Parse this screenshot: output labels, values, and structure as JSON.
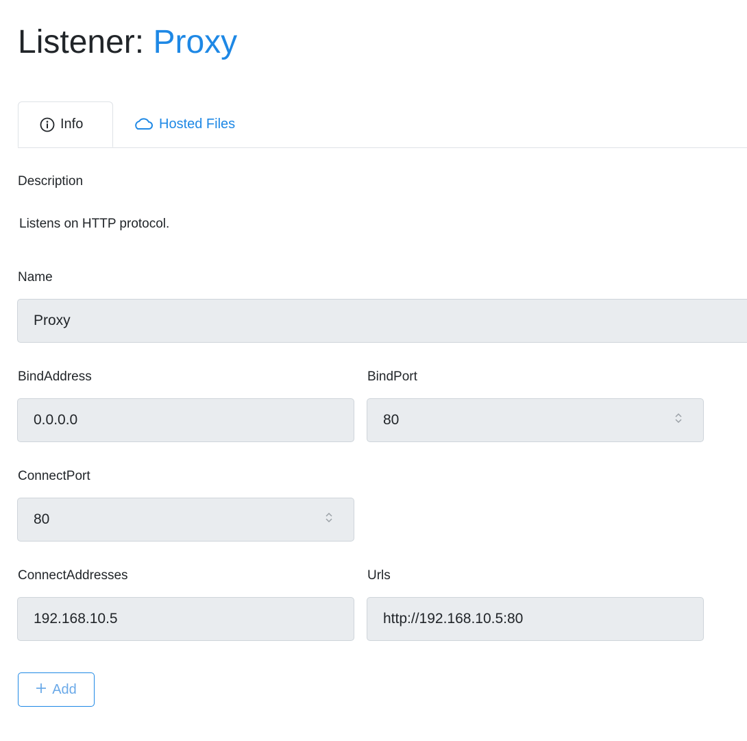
{
  "header": {
    "title_prefix": "Listener:",
    "title_name": "Proxy"
  },
  "tabs": [
    {
      "label": "Info",
      "icon": "info-icon",
      "active": true
    },
    {
      "label": "Hosted Files",
      "icon": "cloud-icon",
      "active": false
    }
  ],
  "form": {
    "description_label": "Description",
    "description_text": "Listens on HTTP protocol.",
    "name_label": "Name",
    "name_value": "Proxy",
    "bind_address_label": "BindAddress",
    "bind_address_value": "0.0.0.0",
    "bind_port_label": "BindPort",
    "bind_port_value": "80",
    "connect_port_label": "ConnectPort",
    "connect_port_value": "80",
    "connect_addresses_label": "ConnectAddresses",
    "connect_addresses_value": "192.168.10.5",
    "urls_label": "Urls",
    "urls_value": "http://192.168.10.5:80",
    "add_label": "Add"
  },
  "colors": {
    "accent": "#1e88e5",
    "field_bg": "#e9ecef",
    "field_border": "#ced4da",
    "text": "#212529"
  }
}
